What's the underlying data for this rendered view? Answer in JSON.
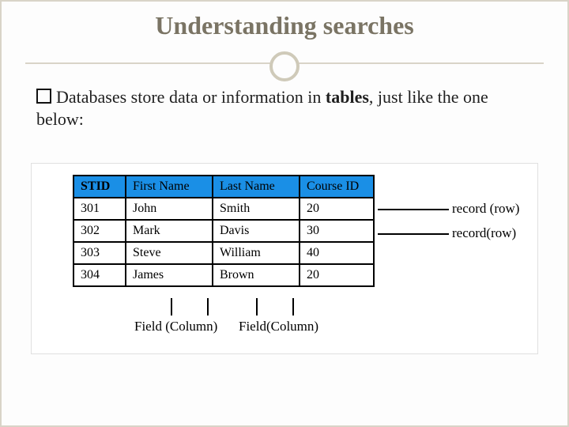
{
  "title": "Understanding searches",
  "body": {
    "pre": "Databases store data or information in ",
    "bold": "tables",
    "post": ", just like the one below:"
  },
  "table": {
    "headers": [
      "STID",
      "First Name",
      "Last Name",
      "Course ID"
    ],
    "rows": [
      [
        "301",
        "John",
        "Smith",
        "20"
      ],
      [
        "302",
        "Mark",
        "Davis",
        "30"
      ],
      [
        "303",
        "Steve",
        "William",
        "40"
      ],
      [
        "304",
        "James",
        "Brown",
        "20"
      ]
    ]
  },
  "annotations": {
    "record_row_1": "record (row)",
    "record_row_2": "record(row)",
    "field_col_1": "Field (Column)",
    "field_col_2": "Field(Column)"
  }
}
